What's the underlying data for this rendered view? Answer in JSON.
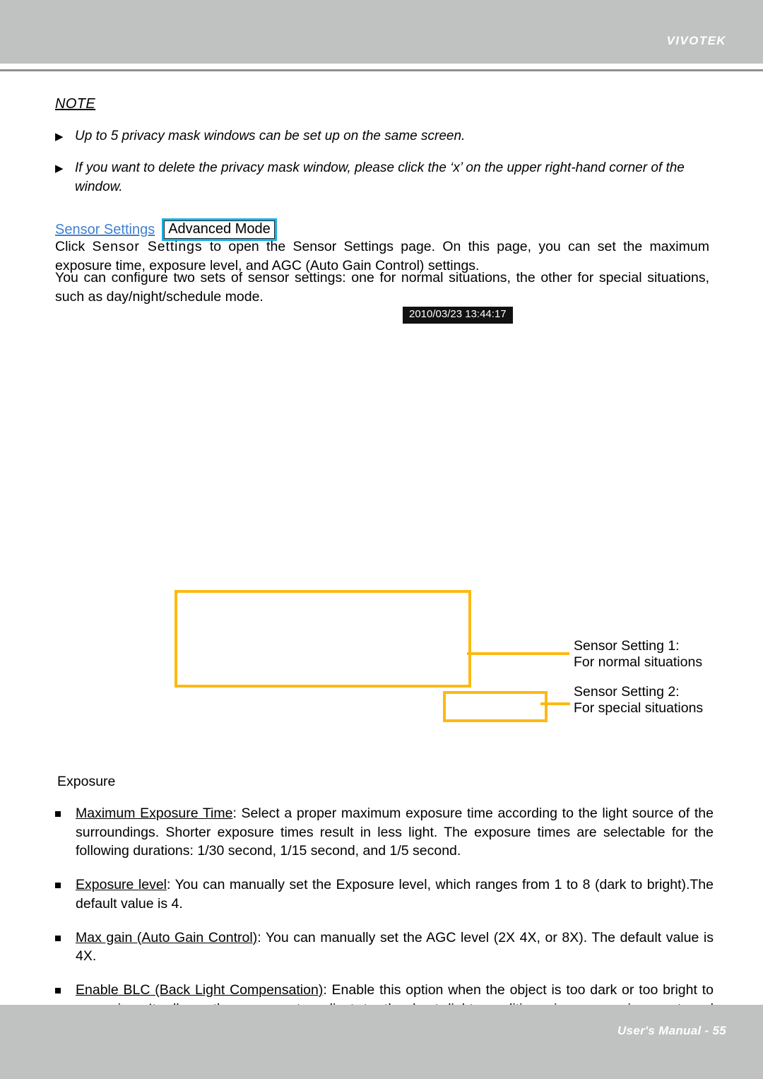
{
  "header": {
    "brand": "VIVOTEK"
  },
  "note": {
    "heading": "NOTE",
    "marker": "▶",
    "items": [
      "Up to 5 privacy mask windows can be set up on the same screen.",
      "If you want to delete the privacy mask window, please click the ‘x’ on the upper right-hand corner of the window."
    ]
  },
  "sensor_settings": {
    "link_label": "Sensor Settings",
    "badge_label": "Advanced Mode",
    "paragraph_1_prefix": "Click ",
    "paragraph_1_spaced": "Sensor Settings",
    "paragraph_1_rest": " to open the Sensor Settings page. On this page, you can set the maximum exposure time, exposure level, and AGC (Auto Gain Control) settings.",
    "paragraph_2": "You can configure two sets of sensor settings: one for normal situations, the other for special situations, such as day/night/schedule mode."
  },
  "screenshot": {
    "timestamp": "2010/03/23 13:44:17",
    "annotations": [
      {
        "line1": "Sensor Setting 1:",
        "line2": "For normal situations"
      },
      {
        "line1": "Sensor Setting 2:",
        "line2": "For special situations"
      }
    ],
    "callout_color": "#fdb913"
  },
  "exposure": {
    "title": "Exposure",
    "bullets": [
      {
        "term": "Maximum Exposure Time",
        "text": ": Select a proper maximum exposure time according to the light source of the surroundings. Shorter exposure times result in less light. The exposure times are selectable for the following durations: 1/30 second, 1/15 second, and 1/5 second."
      },
      {
        "term": "Exposure level",
        "text": ": You can manually set the Exposure level, which ranges from 1 to 8 (dark to bright).The default value is 4."
      },
      {
        "term": "Max gain (Auto Gain Control)",
        "text": ": You can manually set the AGC level (2X 4X, or 8X). The default value is 4X."
      },
      {
        "term": "Enable BLC (Back Light Compensation)",
        "text": ": Enable this option when the object is too dark or too bright to recognize. It allows the camera to adjust to the best light conditions in any environment and automatically give the necessary light compensation."
      }
    ]
  },
  "footer": {
    "text": "User's Manual - 55"
  }
}
